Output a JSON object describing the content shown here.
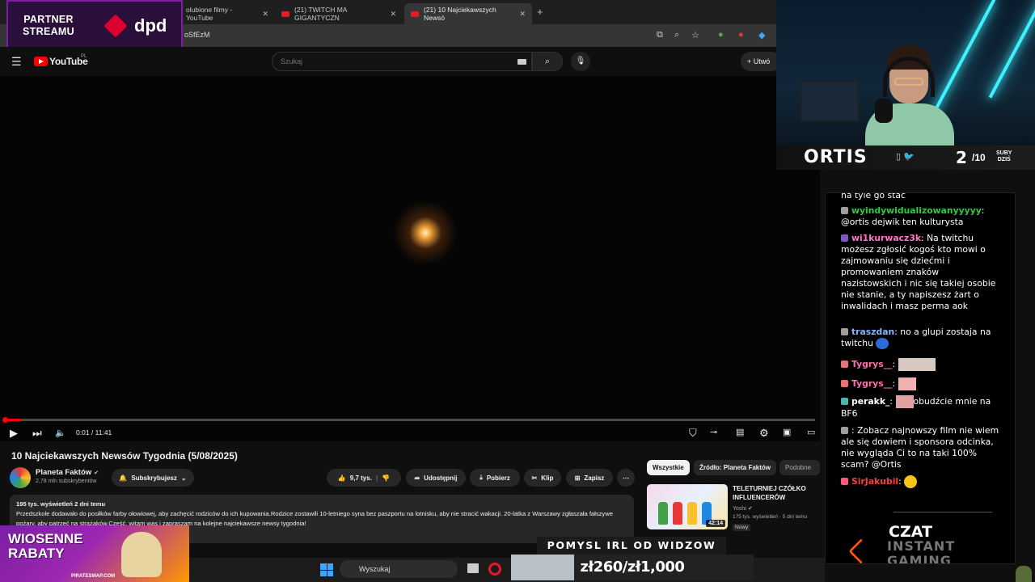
{
  "browser": {
    "tabs": [
      {
        "label": "olubione filmy - YouTube",
        "active": false
      },
      {
        "label": "(21) TWITCH MA GIGANTYCZN",
        "active": false
      },
      {
        "label": "(21) 10 Najciekawszych Newsó",
        "active": true
      }
    ],
    "url": "oSfEzM"
  },
  "partner": {
    "line1": "PARTNER",
    "line2": "STREAMU",
    "brand": "dpd"
  },
  "youtube": {
    "logo": "YouTube",
    "region": "PL",
    "search_placeholder": "Szukaj",
    "create_label": "Utwó"
  },
  "player": {
    "time": "0:01 / 11:41",
    "progress": 0.02
  },
  "video": {
    "title": "10 Najciekawszych Newsów Tygodnia (5/08/2025)",
    "channel": "Planeta Faktów",
    "subscribers": "2,78 mln subskrybentów",
    "subscribe_label": "Subskrybujesz",
    "likes": "9,7 tys.",
    "share_label": "Udostępnij",
    "download_label": "Pobierz",
    "clip_label": "Klip",
    "save_label": "Zapisz",
    "meta": "195 tys. wyświetleń  2 dni temu",
    "description": "Przedszkole dodawało do posiłków farby ołowiowej, aby zachęcić rodziców do ich kupowania.Rodzice zostawili 10-letniego syna bez paszportu na lotnisku, aby nie stracić wakacji. 20-latka z Warszawy zgłaszała fałszywe pożary, aby patrzeć na strażaków.Cześć, witam was i zapraszam na kolejne najciekawsze newsy tygodnia!"
  },
  "related": {
    "chips": [
      "Wszystkie",
      "Źródło: Planeta Faktów",
      "Podobne"
    ],
    "title": "TELETURNIEJ CZÓŁKO INFLUENCERÓW",
    "channel": "Yoshi",
    "meta": "175 tys. wyświetleń · 5 dni temu",
    "new_label": "Nowy",
    "duration": "42:14"
  },
  "stream": {
    "name": "ORTIS",
    "sub_count": "2",
    "sub_goal": "/10",
    "subs_label_1": "SUBY",
    "subs_label_2": "DZIŚ"
  },
  "chat": {
    "messages": [
      {
        "user": "",
        "text": "na tyle go stać",
        "color": "#ffffff"
      },
      {
        "user": "wyindywidualizowanyyyyy",
        "text": "@ortis dejwik ten kulturysta",
        "color": "#2ecc40"
      },
      {
        "user": "wi1kurwacz3k",
        "text": "Na twitchu możesz zgłosić kogoś kto mowi o zajmowaniu się dziećmi i promowaniem znaków nazistowskich i nic się takiej osobie nie stanie, a ty napiszesz żart o inwalidach i masz perma aok",
        "color": "#ff77c8"
      },
      {
        "user": "traszdan",
        "text": "no a glupi zostaja na twitchu",
        "color": "#8ab4f8"
      },
      {
        "user": "Tygrys__",
        "text": "",
        "color": "#ff6fae"
      },
      {
        "user": "Tygrys__",
        "text": "",
        "color": "#ff6fae"
      },
      {
        "user": "perakk_",
        "text": "obudźcie mnie na BF6",
        "color": "#ffffff"
      },
      {
        "user": "",
        "text": "Zobacz najnowszy film nie wiem ale się dowiem i sponsora odcinka, nie wygląda Ci to na taki 100% scam? @Ortis",
        "color": "#ff4d4d"
      },
      {
        "user": "SirJakubil",
        "text": "",
        "color": "#ff3b3b"
      }
    ],
    "footer_title": "CZAT",
    "footer_brand_1": "INSTANT",
    "footer_brand_2": "GAMING"
  },
  "overlays": {
    "rabaty_1": "WIOSENNE",
    "rabaty_2": "RABATY",
    "rabaty_url": "PIRATESWAP.COM",
    "pomysl": "POMYSL IRL OD WIDZOW",
    "goal_text": "zł260/zł1,000",
    "goal_fraction": 0.26
  },
  "taskbar": {
    "search_label": "Wyszukaj"
  },
  "colors": {
    "accent": "#ff0000",
    "purple": "#7b1fa2",
    "neon": "#3ff0ff",
    "dpd": "#dc0032"
  }
}
